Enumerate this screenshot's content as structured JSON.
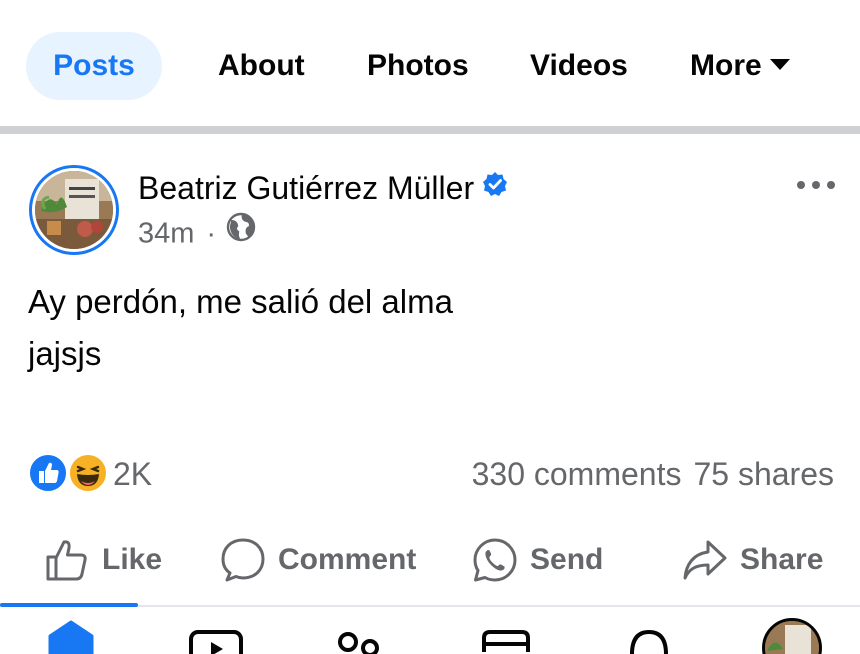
{
  "tabs": [
    {
      "label": "Posts",
      "active": true
    },
    {
      "label": "About"
    },
    {
      "label": "Photos"
    },
    {
      "label": "Videos"
    },
    {
      "label": "More"
    }
  ],
  "post": {
    "author": "Beatriz Gutiérrez Müller",
    "verified": true,
    "time": "34m",
    "separator": "·",
    "audience_icon": "globe-icon",
    "text": "Ay perdón, me salió del alma\njajsjs",
    "reactions": {
      "types": [
        "like-reaction-icon",
        "haha-reaction-icon"
      ],
      "count": "2K"
    },
    "comments": "330 comments",
    "shares": "75 shares"
  },
  "actions": {
    "like": "Like",
    "comment": "Comment",
    "send": "Send",
    "share": "Share"
  },
  "colors": {
    "accent": "#1877f2",
    "accent_bg": "#e7f3ff",
    "secondary_text": "#65676b",
    "primary_text": "#050505",
    "separator": "#ced0d4"
  },
  "bottom_nav": [
    "home-icon",
    "video-icon",
    "friends-icon",
    "marketplace-icon",
    "notifications-icon",
    "profile-avatar"
  ]
}
